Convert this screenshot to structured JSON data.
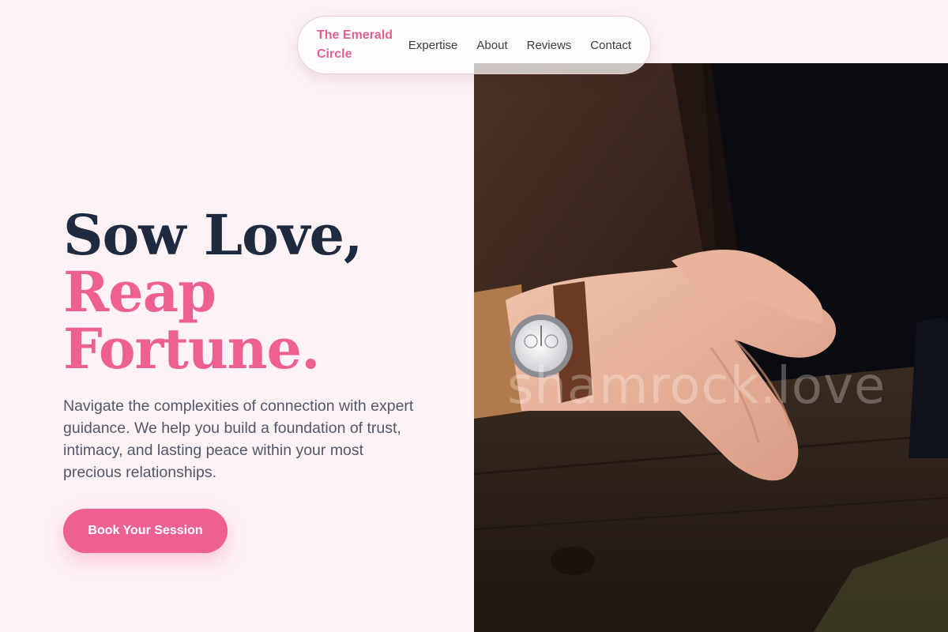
{
  "nav": {
    "brand": "The Emerald Circle",
    "links": [
      "Expertise",
      "About",
      "Reviews",
      "Contact"
    ]
  },
  "hero": {
    "title_line1": "Sow Love,",
    "title_line2": "Reap",
    "title_line3": "Fortune.",
    "description": "Navigate the complexities of connection with expert guidance. We help you build a foundation of trust, intimacy, and lasting peace within your most precious relationships.",
    "cta_label": "Book Your Session"
  },
  "photo": {
    "watermark": "shamrock.love",
    "subject": "clasped-hands-with-wristwatch"
  },
  "colors": {
    "background": "#fdf2f6",
    "accent": "#ee5f92",
    "heading": "#1d2a3f",
    "body_text": "#525767"
  }
}
